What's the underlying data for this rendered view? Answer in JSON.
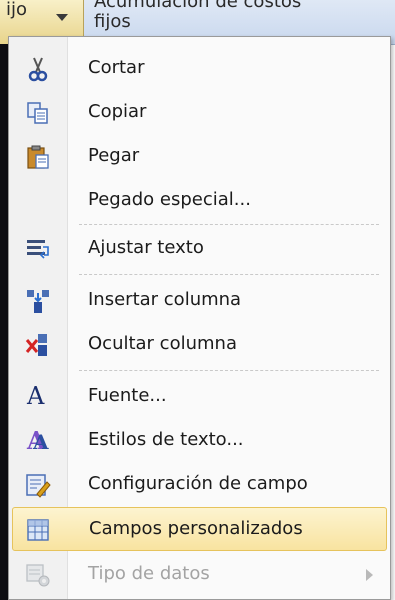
{
  "header": {
    "left_col_partial": "ijo",
    "right_col_line1": "Acumulación de costos",
    "right_col_line2": "fijos"
  },
  "menu": {
    "items": [
      {
        "label": "Cortar",
        "icon": "scissors-icon"
      },
      {
        "label": "Copiar",
        "icon": "copy-icon"
      },
      {
        "label": "Pegar",
        "icon": "paste-icon"
      },
      {
        "label": "Pegado especial...",
        "icon": ""
      },
      {
        "label": "Ajustar texto",
        "icon": "wrap-text-icon"
      },
      {
        "label": "Insertar columna",
        "icon": "insert-column-icon"
      },
      {
        "label": "Ocultar columna",
        "icon": "hide-column-icon"
      },
      {
        "label": "Fuente...",
        "icon": "font-icon"
      },
      {
        "label": "Estilos de texto...",
        "icon": "text-styles-icon"
      },
      {
        "label": "Configuración de campo",
        "icon": "field-settings-icon"
      },
      {
        "label": "Campos personalizados",
        "icon": "custom-fields-icon",
        "highlighted": true
      },
      {
        "label": "Tipo de datos",
        "icon": "data-type-icon",
        "disabled": true,
        "has_submenu": true
      }
    ]
  },
  "colors": {
    "highlight": "#f8e3a0",
    "highlight_border": "#e6c35c",
    "disabled_text": "#a3a3a3"
  }
}
